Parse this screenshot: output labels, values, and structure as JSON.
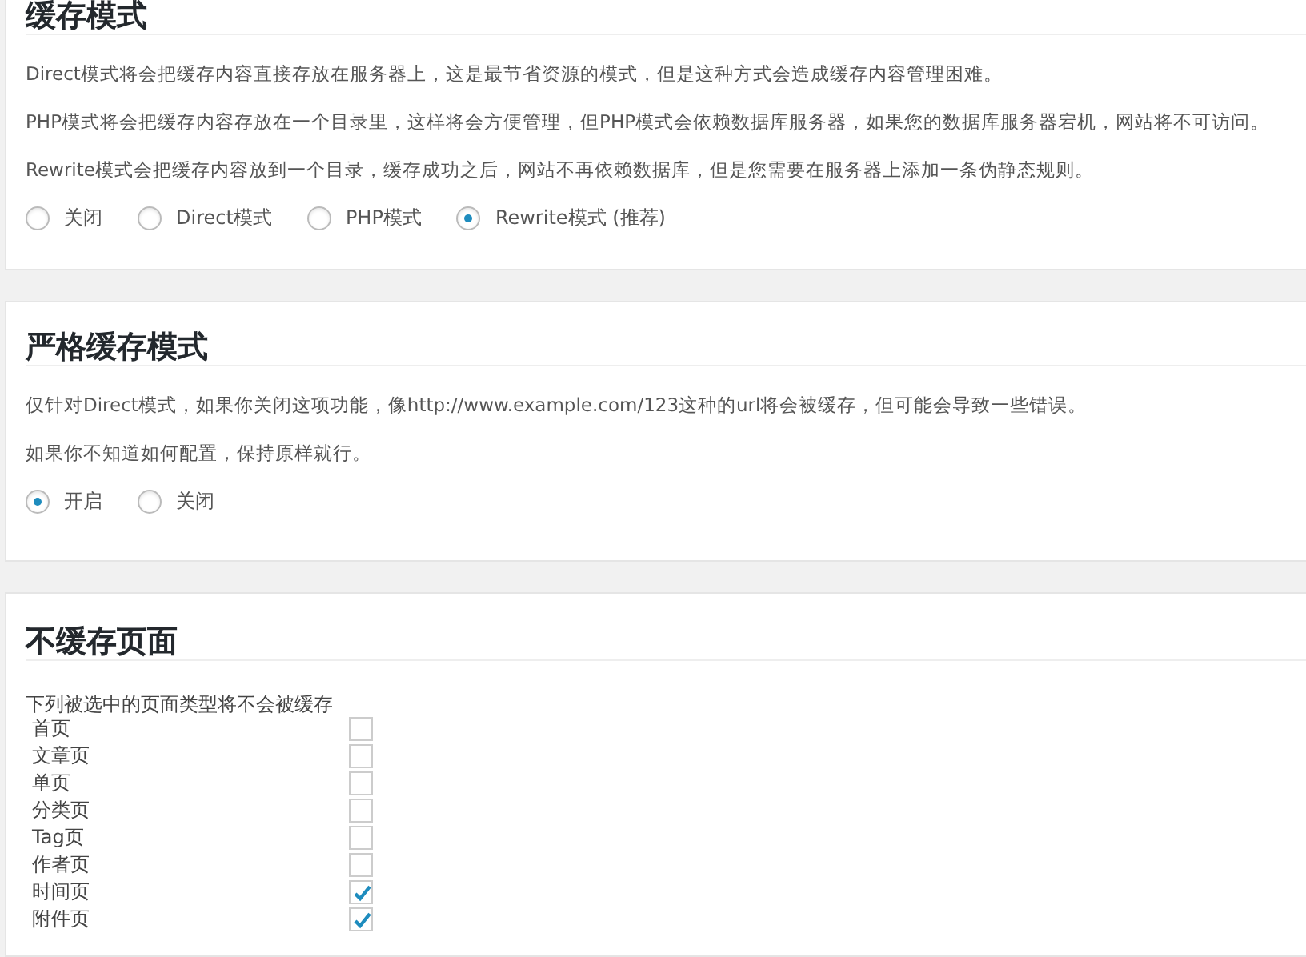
{
  "sections": [
    {
      "kind": "radio",
      "title": "缓存模式",
      "paragraphs": [
        "Direct模式将会把缓存内容直接存放在服务器上，这是最节省资源的模式，但是这种方式会造成缓存内容管理困难。",
        "PHP模式将会把缓存内容存放在一个目录里，这样将会方便管理，但PHP模式会依赖数据库服务器，如果您的数据库服务器宕机，网站将不可访问。",
        "Rewrite模式会把缓存内容放到一个目录，缓存成功之后，网站不再依赖数据库，但是您需要在服务器上添加一条伪静态规则。"
      ],
      "options": [
        {
          "label": "关闭",
          "selected": false
        },
        {
          "label": "Direct模式",
          "selected": false
        },
        {
          "label": "PHP模式",
          "selected": false
        },
        {
          "label": "Rewrite模式 (推荐)",
          "selected": true
        }
      ]
    },
    {
      "kind": "radio",
      "title": "严格缓存模式",
      "paragraphs": [
        "仅针对Direct模式，如果你关闭这项功能，像http://www.example.com/123这种的url将会被缓存，但可能会导致一些错误。",
        "如果你不知道如何配置，保持原样就行。"
      ],
      "options": [
        {
          "label": "开启",
          "selected": true
        },
        {
          "label": "关闭",
          "selected": false
        }
      ]
    },
    {
      "kind": "checkbox",
      "title": "不缓存页面",
      "caption": "下列被选中的页面类型将不会被缓存",
      "items": [
        {
          "label": "首页",
          "checked": false
        },
        {
          "label": "文章页",
          "checked": false
        },
        {
          "label": "单页",
          "checked": false
        },
        {
          "label": "分类页",
          "checked": false
        },
        {
          "label": "Tag页",
          "checked": false
        },
        {
          "label": "作者页",
          "checked": false
        },
        {
          "label": "时间页",
          "checked": true
        },
        {
          "label": "附件页",
          "checked": true
        }
      ]
    }
  ]
}
